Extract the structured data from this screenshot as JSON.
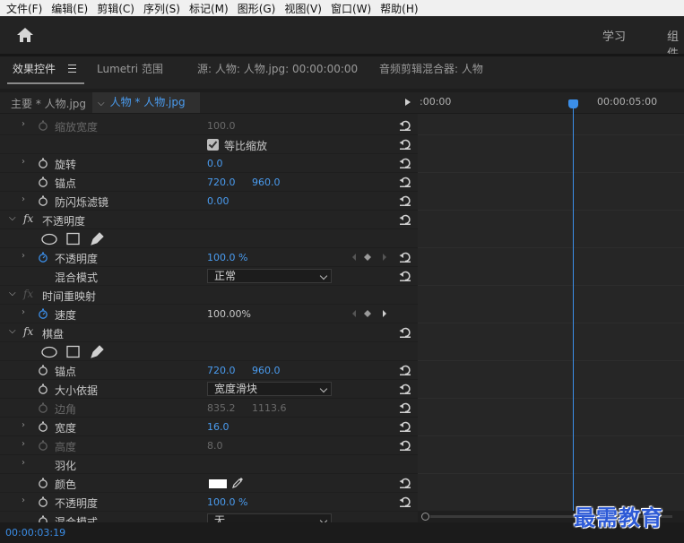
{
  "menu": [
    "文件(F)",
    "编辑(E)",
    "剪辑(C)",
    "序列(S)",
    "标记(M)",
    "图形(G)",
    "视图(V)",
    "窗口(W)",
    "帮助(H)"
  ],
  "workspace": {
    "home_icon": "home-icon",
    "items": [
      "学习",
      "组件"
    ]
  },
  "tabs": {
    "effect_controls": "效果控件",
    "lumetri": "Lumetri 范围",
    "source": "源: 人物: 人物.jpg: 00:00:00:00",
    "audio_mixer": "音频剪辑混合器: 人物"
  },
  "clip": {
    "master": "主要 * 人物.jpg",
    "current": "人物 * 人物.jpg"
  },
  "ruler": {
    "start": ":00:00",
    "mark": "00:00:05:00"
  },
  "rows": [
    {
      "label": "缩放宽度",
      "v1": "100.0"
    },
    {
      "checkbox_label": "等比缩放"
    },
    {
      "label": "旋转",
      "v1": "0.0"
    },
    {
      "label": "锚点",
      "v1": "720.0",
      "v2": "960.0"
    },
    {
      "label": "防闪烁滤镜",
      "v1": "0.00"
    },
    {
      "label": "不透明度"
    },
    {},
    {
      "label": "不透明度",
      "v1": "100.0 %"
    },
    {
      "label": "混合模式",
      "dropdown": "正常"
    },
    {
      "label": "时间重映射"
    },
    {
      "label": "速度",
      "v1": "100.00%"
    },
    {
      "label": "棋盘"
    },
    {},
    {
      "label": "锚点",
      "v1": "720.0",
      "v2": "960.0"
    },
    {
      "label": "大小依据",
      "dropdown": "宽度滑块"
    },
    {
      "label": "边角",
      "v1": "835.2",
      "v2": "1113.6"
    },
    {
      "label": "宽度",
      "v1": "16.0"
    },
    {
      "label": "高度",
      "v1": "8.0"
    },
    {
      "label": "羽化"
    },
    {
      "label": "颜色"
    },
    {
      "label": "不透明度",
      "v1": "100.0 %"
    },
    {
      "label": "混合模式",
      "dropdown": "无"
    }
  ],
  "status": {
    "timecode": "00:00:03:19"
  },
  "watermark": "最需教育",
  "colors": {
    "accent": "#3b8ee8",
    "panel": "#232323",
    "text": "#c8c8c8"
  }
}
